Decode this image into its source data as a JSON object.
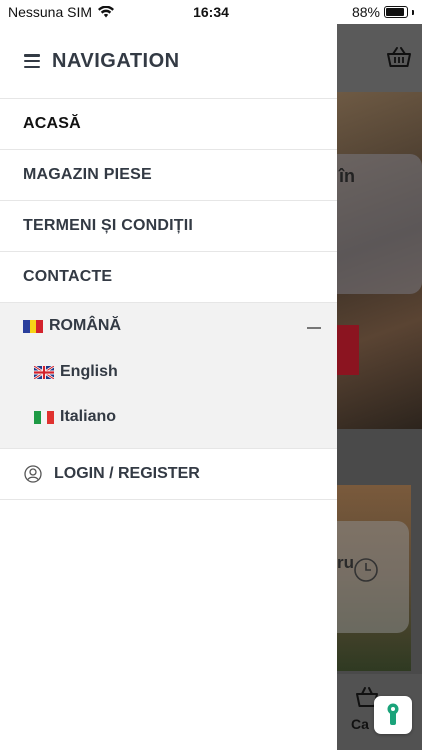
{
  "status_bar": {
    "carrier": "Nessuna SIM",
    "time": "16:34",
    "battery": "88%",
    "battery_level": 0.88
  },
  "drawer": {
    "title": "NAVIGATION",
    "menu": [
      {
        "label": "ACASĂ",
        "active": true
      },
      {
        "label": "MAGAZIN PIESE"
      },
      {
        "label": "TERMENI ȘI CONDIȚII"
      },
      {
        "label": "CONTACTE"
      }
    ],
    "languages": {
      "current": "ROMÂNĂ",
      "options": [
        {
          "label": "English",
          "flag": "gb-flag-icon"
        },
        {
          "label": "Italiano",
          "flag": "it-flag-icon"
        }
      ]
    },
    "login_label": "LOGIN / REGISTER"
  },
  "background_app": {
    "hero_text_fragment": "în",
    "card_text_fragment": "ru",
    "footer_label_fragment": "Ca"
  },
  "colors": {
    "text": "#333a44",
    "divider": "#e6e6e6",
    "lang_bg": "#f2f2f2",
    "overlay": "#4a4a4a"
  }
}
